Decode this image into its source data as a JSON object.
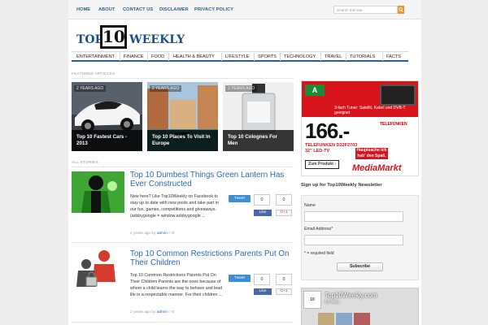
{
  "topnav": {
    "items": [
      "HOME",
      "ABOUT",
      "CONTACT US",
      "DISCLAIMER",
      "PRIVACY POLICY"
    ],
    "search_placeholder": "Search this site..."
  },
  "logo": {
    "part1": "TOP",
    "part2": "10",
    "part3": "WEEKLY"
  },
  "mainnav": [
    "ENTERTAINMENT",
    "FINANCE",
    "FOOD",
    "HEALTH & BEAUTY",
    "LIFESTYLE",
    "SPORTS",
    "TECHNOLOGY",
    "TRAVEL",
    "TUTORIALS",
    "FACTS"
  ],
  "featured": {
    "label": "FEATURED ARTICLES",
    "items": [
      {
        "age": "2 YEARS AGO",
        "title": "Top 10 Fastest Cars - 2013"
      },
      {
        "age": "2 YEARS AGO",
        "title": "Top 10 Places To Visit In Europe"
      },
      {
        "age": "2 YEARS AGO",
        "title": "Top 10 Colognes For Men"
      }
    ]
  },
  "stories": {
    "label": "ALL STORIES",
    "items": [
      {
        "title": "Top 10 Dumbest Things Green Lantern Has Ever Constructed",
        "excerpt": "New here? Like Top10Weekly on Facebook to stay up to date with new posts and take part in our fun, games, competitions and giveaways. (adsbygoogle = window.adsbygoogle ...",
        "age": "2 years ago by",
        "author": "admin",
        "comments": "0",
        "tweet": "Tweet",
        "tweet_count": "0",
        "like": "Like",
        "like_count": "0",
        "gplus": "G+1",
        "gplus_count": "0"
      },
      {
        "title": "Top 10 Common Restrictions Parents Put On Their Children",
        "excerpt": "Top 10 Common Restrictions Parents Put On Their Children Parents are the ones because of whom a child learns the way to behave and lead life in a respectable manner. For their children ...",
        "age": "2 years ago by",
        "author": "admin",
        "comments": "0",
        "tweet": "Tweet",
        "tweet_count": "0",
        "like": "Like",
        "like_count": "0",
        "gplus": "G+1",
        "gplus_count": "0"
      }
    ]
  },
  "ad": {
    "price": "166.-",
    "headline": "TELEFUNKEN D32F2703",
    "subline": "32\" LED-TV",
    "brand": "MediaMarkt",
    "cta": "Zum Produkt ›",
    "tag": "Hauptsache ich hab' den Spaß.",
    "energy": "A",
    "promo": "3-fach Tuner: Satellit, Kabel und DVB-T geeignet",
    "logo2": "TELEFUNKEN"
  },
  "newsletter": {
    "title": "Sign up for Top10Weekly Newsletter",
    "name_label": "Name",
    "email_label": "Email Address*",
    "required_note": "* = required field",
    "subscribe": "Subscribe"
  },
  "fbbox": {
    "page_name": "Top10Weekly.com",
    "likes": "4.6 likes"
  },
  "colors": {
    "accent": "#2a6ab1",
    "nav_border": "#2a5f98",
    "search_btn": "#f0932b",
    "ad_red": "#d7141b"
  }
}
